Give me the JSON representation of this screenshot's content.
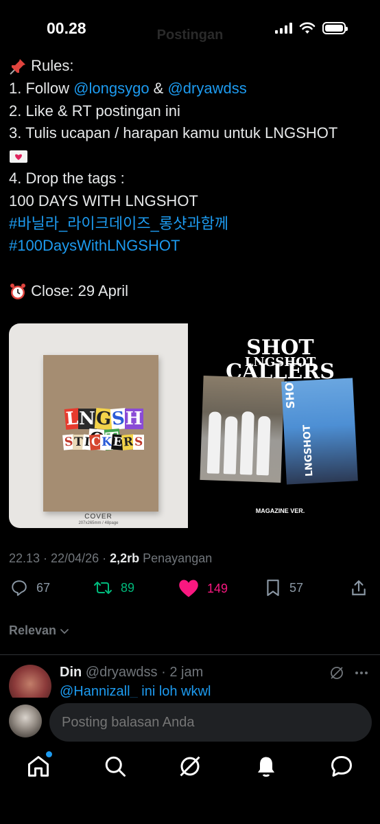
{
  "status_bar": {
    "time": "00.28",
    "ghost_title": "Postingan"
  },
  "tweet": {
    "lines": {
      "rules_heading": "Rules:",
      "rule1_prefix": "1. Follow ",
      "mention1": "@longsygo",
      "amp": " & ",
      "mention2": "@dryawdss",
      "rule2": "2. Like & RT postingan ini",
      "rule3": "3. Tulis ucapan / harapan kamu untuk LNGSHOT",
      "rule4": "4. Drop the tags :",
      "tag_plain": "100 DAYS WITH LNGSHOT",
      "hashtag1": "#바닐라_라이크데이즈_롱샷과함께",
      "hashtag2": "#100DaysWithLNGSHOT",
      "close": "Close: 29 April"
    },
    "emoji": {
      "pin": "pushpin-emoji",
      "heart_letter": "love-letter-emoji",
      "clock": "alarm-clock-emoji"
    }
  },
  "media": {
    "left": {
      "title_letters": [
        "L",
        "N",
        "G",
        "S",
        "H",
        "O",
        "T"
      ],
      "sub_letters": [
        "S",
        "T",
        "I",
        "C",
        "K",
        "E",
        "R",
        "S"
      ],
      "cover_label": "COVER",
      "cover_size": "207x265mm / 48page"
    },
    "right": {
      "title": "SHOT CALLERS",
      "subtitle": "LNGSHOT",
      "vertical1": "SHOTCALLERS",
      "vertical2": "LNGSHOT",
      "version": "MAGAZINE VER."
    }
  },
  "meta": {
    "time": "22.13 · 22/04/26 · ",
    "views": "2,2rb",
    "views_label": " Penayangan"
  },
  "actions": {
    "replies": "67",
    "reposts": "89",
    "likes": "149",
    "bookmarks": "57"
  },
  "sort": {
    "label": "Relevan"
  },
  "reply": {
    "name": "Din",
    "handle": "@dryawdss",
    "time": " · 2 jam",
    "text": "@Hannizall_ ini loh wkwl"
  },
  "composer": {
    "placeholder": "Posting balasan Anda"
  },
  "colors": {
    "link": "#1d9bf0",
    "repost": "#00ba7c",
    "like": "#f91880",
    "muted": "#71767b"
  }
}
